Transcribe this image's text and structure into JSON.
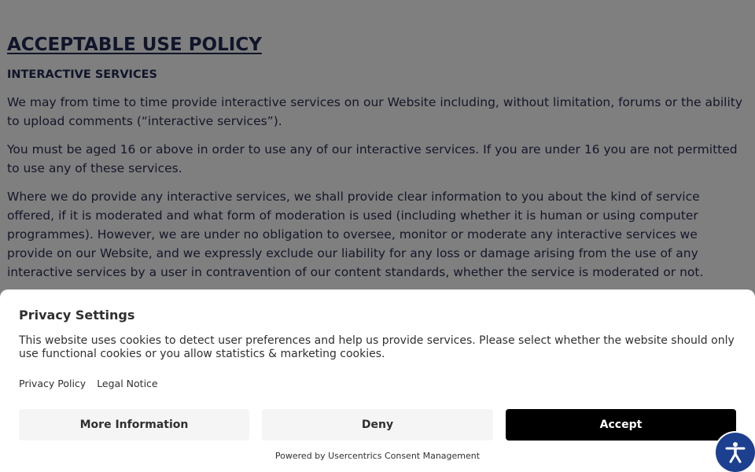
{
  "policy": {
    "title": "ACCEPTABLE USE POLICY",
    "section_heading": "INTERACTIVE SERVICES",
    "paragraphs": [
      "We may from time to time provide interactive services on our Website including, without limitation, forums or the ability to upload comments (“interactive services”).",
      "You must be aged 16 or above in order to use any of our interactive services. If you are under 16 you are not permitted to use any of these services.",
      "Where we do provide any interactive services, we shall provide clear information to you about the kind of service offered, if it is moderated and what form of moderation is used (including whether it is human or using computer programmes). However, we are under no obligation to oversee, monitor or moderate any interactive services we provide on our Website, and we expressly exclude our liability for any loss or damage arising from the use of any interactive services by a user in contravention of our content standards, whether the service is moderated or not."
    ]
  },
  "consent": {
    "title": "Privacy Settings",
    "description": "This website uses cookies to detect user preferences and help us provide services. Please select whether the website should only use functional cookies or you allow statistics & marketing cookies.",
    "links": {
      "privacy_policy": "Privacy Policy",
      "legal_notice": "Legal Notice"
    },
    "buttons": {
      "more_info": "More Information",
      "deny": "Deny",
      "accept": "Accept"
    },
    "powered_by": "Powered by Usercentrics Consent Management"
  },
  "accessibility": {
    "icon": "accessibility-person-icon",
    "color": "#1c3f8f"
  },
  "colors": {
    "overlay": "rgba(0,0,0,0.5)",
    "accept_bg": "#000000",
    "secondary_btn_bg": "#f5f5f5",
    "text_navy": "#222a55"
  }
}
